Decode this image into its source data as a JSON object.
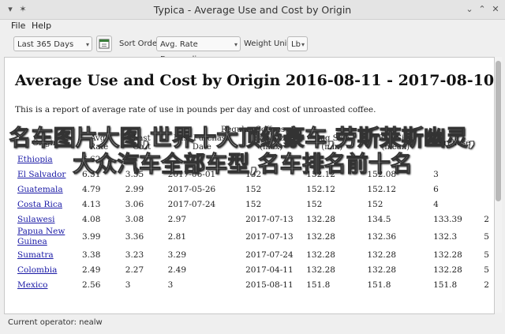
{
  "window": {
    "title": "Typica - Average Use and Cost by Origin"
  },
  "menubar": {
    "file": "File",
    "help": "Help"
  },
  "toolbar": {
    "date_range": "Last 365 Days",
    "sort_order_label": "Sort Order:",
    "sort_order": "Avg. Rate Descending",
    "weight_unit_label": "Weight Unit:",
    "weight_unit": "Lb"
  },
  "report": {
    "heading": "Average Use and Cost by Origin 2016-08-11 - 2017-08-10",
    "intro": "This is a report of average rate of use in pounds per day and cost of unroasted coffee.",
    "group_header": "Regular Coffees",
    "columns": [
      "Origin",
      "Avg. Rate",
      "Last Cost",
      "Last Purchase Date",
      "Bag Size (max)",
      "Bag Size (min)",
      "Bag Size (mean)",
      "Purchases"
    ],
    "rows": [
      [
        "Ethiopia",
        "6.62",
        "",
        "",
        "",
        "",
        "",
        ""
      ],
      [
        "El Salvador",
        "6.51",
        "3.55",
        "2017-06-01",
        "152",
        "152.12",
        "152.08",
        "3"
      ],
      [
        "Guatemala",
        "4.79",
        "2.99",
        "2017-05-26",
        "152",
        "152.12",
        "152.12",
        "6"
      ],
      [
        "Costa Rica",
        "4.13",
        "3.06",
        "2017-07-24",
        "152",
        "152",
        "152",
        "4"
      ],
      [
        "Sulawesi",
        "4.08",
        "3.08",
        "2.97",
        "2017-07-13",
        "132.28",
        "134.5",
        "133.39",
        "2"
      ],
      [
        "Papua New Guinea",
        "3.99",
        "3.36",
        "2.81",
        "2017-07-13",
        "132.28",
        "132.36",
        "132.3",
        "5"
      ],
      [
        "Sumatra",
        "3.38",
        "3.23",
        "3.29",
        "2017-07-24",
        "132.28",
        "132.28",
        "132.28",
        "5"
      ],
      [
        "Colombia",
        "2.49",
        "2.27",
        "2.49",
        "2017-04-11",
        "132.28",
        "132.28",
        "132.28",
        "5"
      ],
      [
        "Mexico",
        "2.56",
        "3",
        "3",
        "2015-08-11",
        "151.8",
        "151.8",
        "151.8",
        "2"
      ]
    ]
  },
  "overlay_text": "名车图片大图,世界十大顶级豪车,劳斯莱斯幽灵,大众汽车全部车型,名车排名前十名",
  "statusbar": {
    "text": "Current operator: nealw"
  }
}
